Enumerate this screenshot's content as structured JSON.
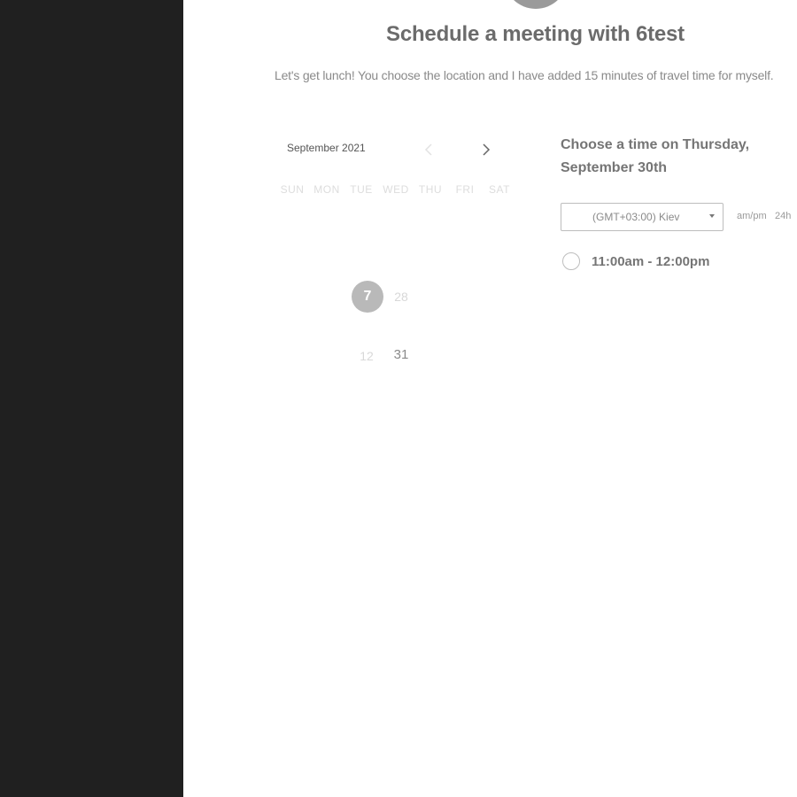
{
  "header": {
    "title": "Schedule a meeting with 6test",
    "description": "Let's get lunch! You choose the location and I have added 15 minutes of travel time for myself."
  },
  "calendar": {
    "month_label": "September 2021",
    "weekdays": [
      "SUN",
      "MON",
      "TUE",
      "WED",
      "THU",
      "FRI",
      "SAT"
    ],
    "selected_day": "7",
    "days": [
      "28",
      "12",
      "31"
    ]
  },
  "timepicker": {
    "heading": "Choose a time on Thursday, September 30th",
    "timezone": "(GMT+03:00) Kiev",
    "format_ampm": "am/pm",
    "format_24h": "24h",
    "slots": [
      "11:00am - 12:00pm"
    ]
  },
  "icons": {
    "prev": "chevron-left-icon",
    "next": "chevron-right-icon",
    "dropdown": "caret-down-icon"
  }
}
